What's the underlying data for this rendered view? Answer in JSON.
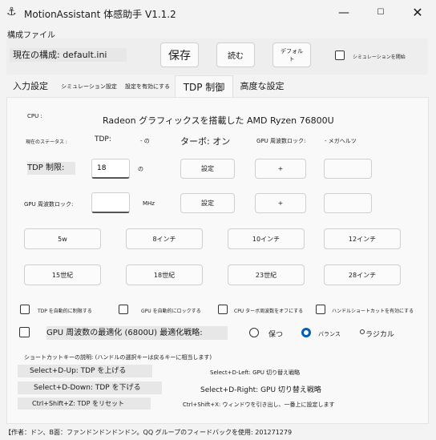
{
  "window": {
    "title": "MotionAssistant 体感助手 V1.1.2",
    "minimize": "—",
    "maximize": "☐",
    "close": "✕"
  },
  "config": {
    "section_label": "構成ファイル",
    "current_label": "現在の構成: default.ini",
    "save": "保存",
    "read": "読む",
    "default": "デフォルト",
    "simulation_open": "シミュレーションを開始"
  },
  "tabs": [
    "入力設定",
    "シミュレーション設定",
    "設定を有効にする",
    "TDP 制御",
    "高度な設定"
  ],
  "tdp": {
    "cpu_label": "CPU :",
    "cpu_name": "Radeon グラフィックスを搭載した AMD Ryzen 76800U",
    "status_label": "現在のステータス :",
    "tdp_label": "TDP:",
    "tdp_value": "- の",
    "turbo": "ターボ: オン",
    "gpu_freq_label": "GPU 周波数ロック:",
    "gpu_freq_value": "- メガヘルツ",
    "tdp_limit_label": "TDP 制限:",
    "tdp_limit_value": "18",
    "tdp_unit": "の",
    "set_btn": "設定",
    "plus_btn": "+",
    "gpu_lock_label": "GPU 周波数ロック:",
    "gpu_lock_value": "",
    "mhz": "MHz",
    "set_btn2": "設定",
    "plus_btn2": "+"
  },
  "presets": [
    "5w",
    "8インチ",
    "10インチ",
    "12インチ",
    "15世紀",
    "18世紀",
    "23世紀",
    "28インチ"
  ],
  "options": {
    "auto_tdp": "TDP を自動的に制限する",
    "auto_gpu": "GPU を自動的にロックする",
    "cpu_turbo_off": "CPU ターボ周波数をオフにする",
    "handle_shortcut": "ハンドルショートカットを有効にする",
    "gpu_opt": "GPU 周波数の最適化 (6800U) 最適化戦略:",
    "strategy_keep": "保つ",
    "strategy_balance": "バランス",
    "strategy_radical": "ラジカル",
    "strategy_selected": "バランス"
  },
  "shortcuts": {
    "title": "ショートカットキーの説明: (ハンドルの選択キーは戻るキーに相当します)",
    "s1": "Select+D-Up: TDP を上げる",
    "s2": "Select+D-Left: GPU 切り替え戦略",
    "s3": "Select+D-Down: TDP を下げる",
    "s4": "Select+D-Right: GPU 切り替え戦略",
    "s5": "Ctrl+Shift+Z: TDP をリセット",
    "s6": "Ctrl+Shift+X: ウィンドウを引き出し、一番上に設定します"
  },
  "status_bar": "【作者：ドン、B面：ファンドンドンドンドン。QQ グループのフィードバックを使用: 201271279"
}
